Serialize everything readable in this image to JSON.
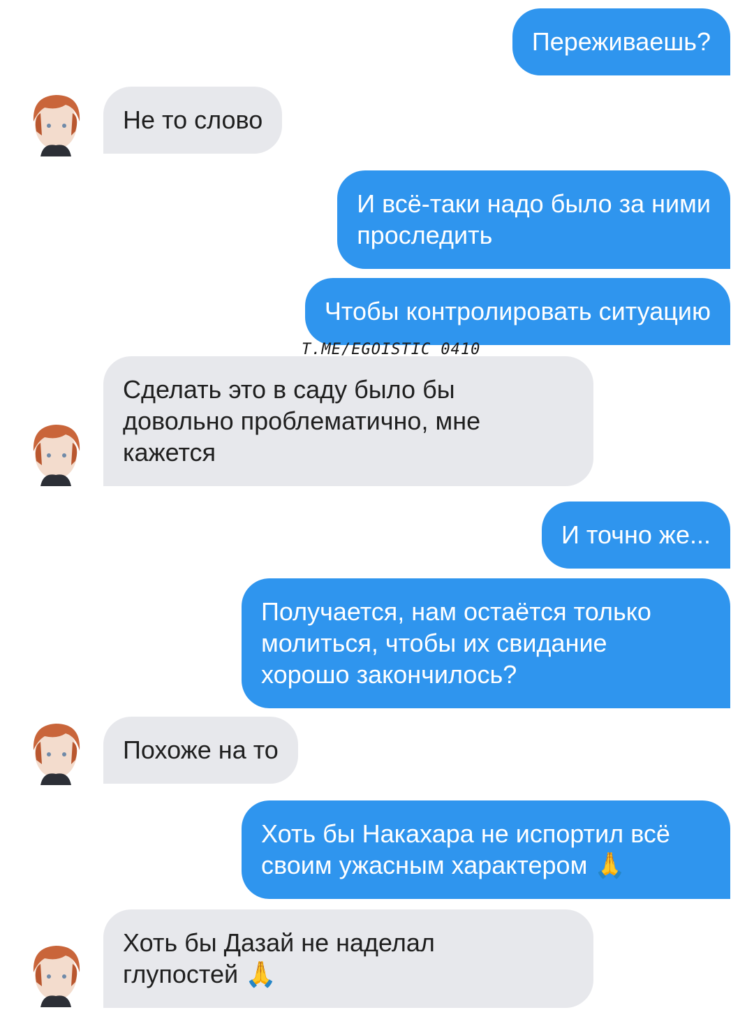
{
  "messages": [
    {
      "side": "out",
      "text": "Переживаешь?"
    },
    {
      "side": "in",
      "text": "Не то слово"
    },
    {
      "side": "out",
      "text": "И всё-таки надо было за ними\nпроследить"
    },
    {
      "side": "out",
      "text": "Чтобы контролировать ситуацию"
    },
    {
      "side": "in",
      "text": "Сделать это в саду было бы\nдовольно проблематично, мне\nкажется"
    },
    {
      "side": "out",
      "text": "И точно же..."
    },
    {
      "side": "out",
      "text": "Получается, нам остаётся только\nмолиться, чтобы их свидание\nхорошо закончилось?"
    },
    {
      "side": "in",
      "text": "Похоже на то"
    },
    {
      "side": "out",
      "text": "Хоть бы Накахара не испортил всё\nсвоим ужасным характером 🙏"
    },
    {
      "side": "in",
      "text": "Хоть бы Дазай не наделал\nглупостей 🙏"
    }
  ],
  "watermark": "T.ME/EGOISTIC_0410",
  "colors": {
    "outgoing_bubble": "#2f95ee",
    "incoming_bubble": "#e7e8ec",
    "outgoing_text": "#ffffff",
    "incoming_text": "#1f1f1f"
  },
  "avatar_icon": "anime-avatar-icon"
}
